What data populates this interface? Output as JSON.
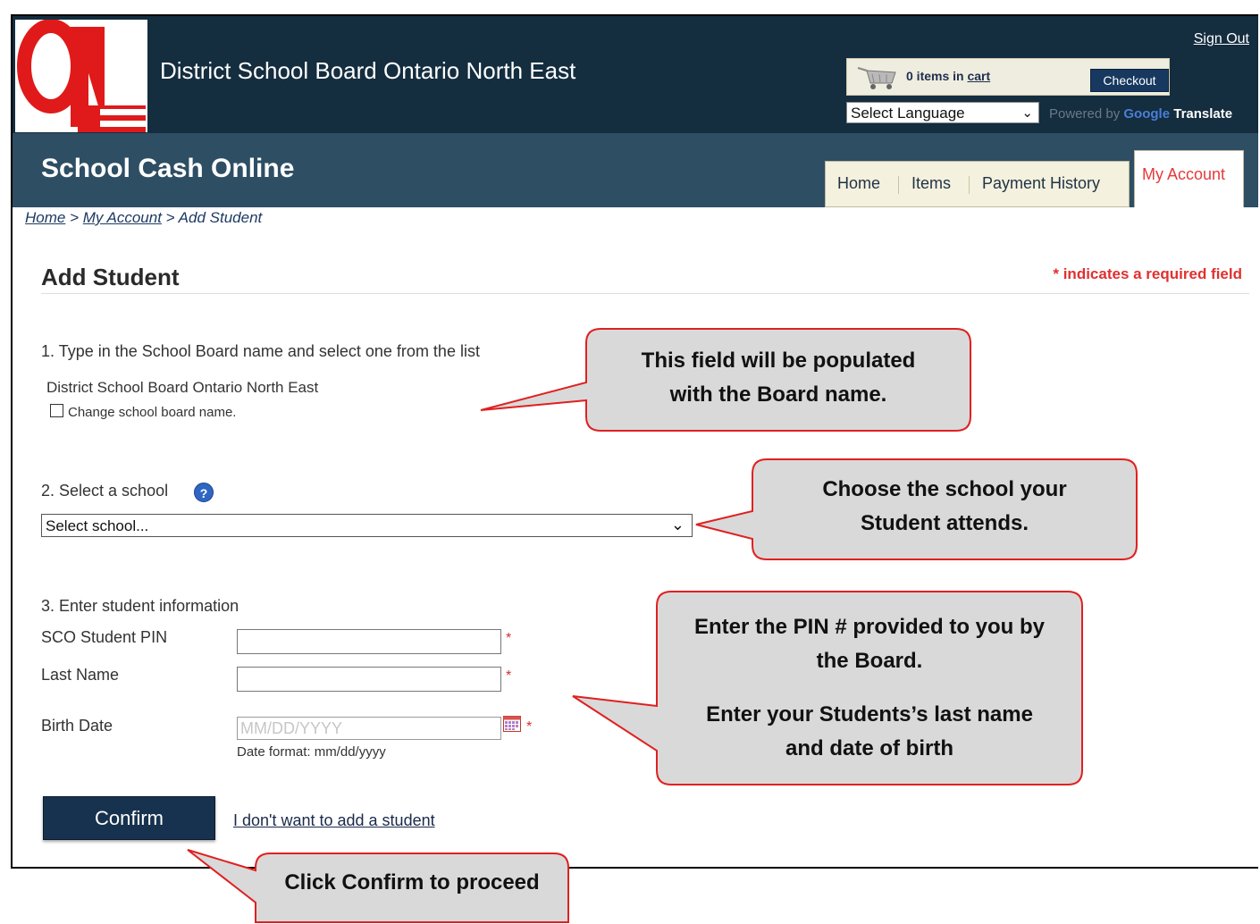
{
  "header": {
    "board_title": "District School Board Ontario North East",
    "sign_out": "Sign Out",
    "cart": {
      "count_text": "0 items in ",
      "link_text": "cart",
      "checkout": "Checkout"
    },
    "language_select": "Select Language",
    "powered_by": "Powered by ",
    "google": "Google",
    "translate": "Translate"
  },
  "banner": {
    "title": "School Cash Online",
    "tabs": [
      "Home",
      "Items",
      "Payment History"
    ],
    "active_tab": "My Account"
  },
  "breadcrumb": {
    "home": "Home",
    "sep": " > ",
    "account": "My Account",
    "current": "Add Student"
  },
  "page": {
    "title": "Add Student",
    "required_note": "* indicates a required field",
    "step1": "1. Type in the School Board name and select one from the list",
    "board_value": "District School Board Ontario North East",
    "change_board": "Change school board name.",
    "step2": "2. Select a school",
    "school_select": "Select school...",
    "step3": "3. Enter student information",
    "pin_label": "SCO Student PIN",
    "lastname_label": "Last Name",
    "birthdate_label": "Birth Date",
    "birthdate_placeholder": "MM/DD/YYYY",
    "date_format": "Date format: mm/dd/yyyy",
    "required_star": "*",
    "confirm": "Confirm",
    "no_student": "I don't want to add a student"
  },
  "callouts": {
    "board": [
      "This field will be populated",
      "with the Board name."
    ],
    "school": [
      "Choose the school your",
      "Student attends."
    ],
    "pin": [
      "Enter the PIN # provided to you by",
      "the Board.",
      "Enter your Students’s last name",
      "and date of birth"
    ],
    "confirm": [
      "Click Confirm to proceed"
    ]
  },
  "colors": {
    "header": "#142d3f",
    "banner": "#2e4e64",
    "accent_red": "#e03030",
    "callout_fill": "#d9d9d9",
    "callout_border": "#e02020"
  }
}
